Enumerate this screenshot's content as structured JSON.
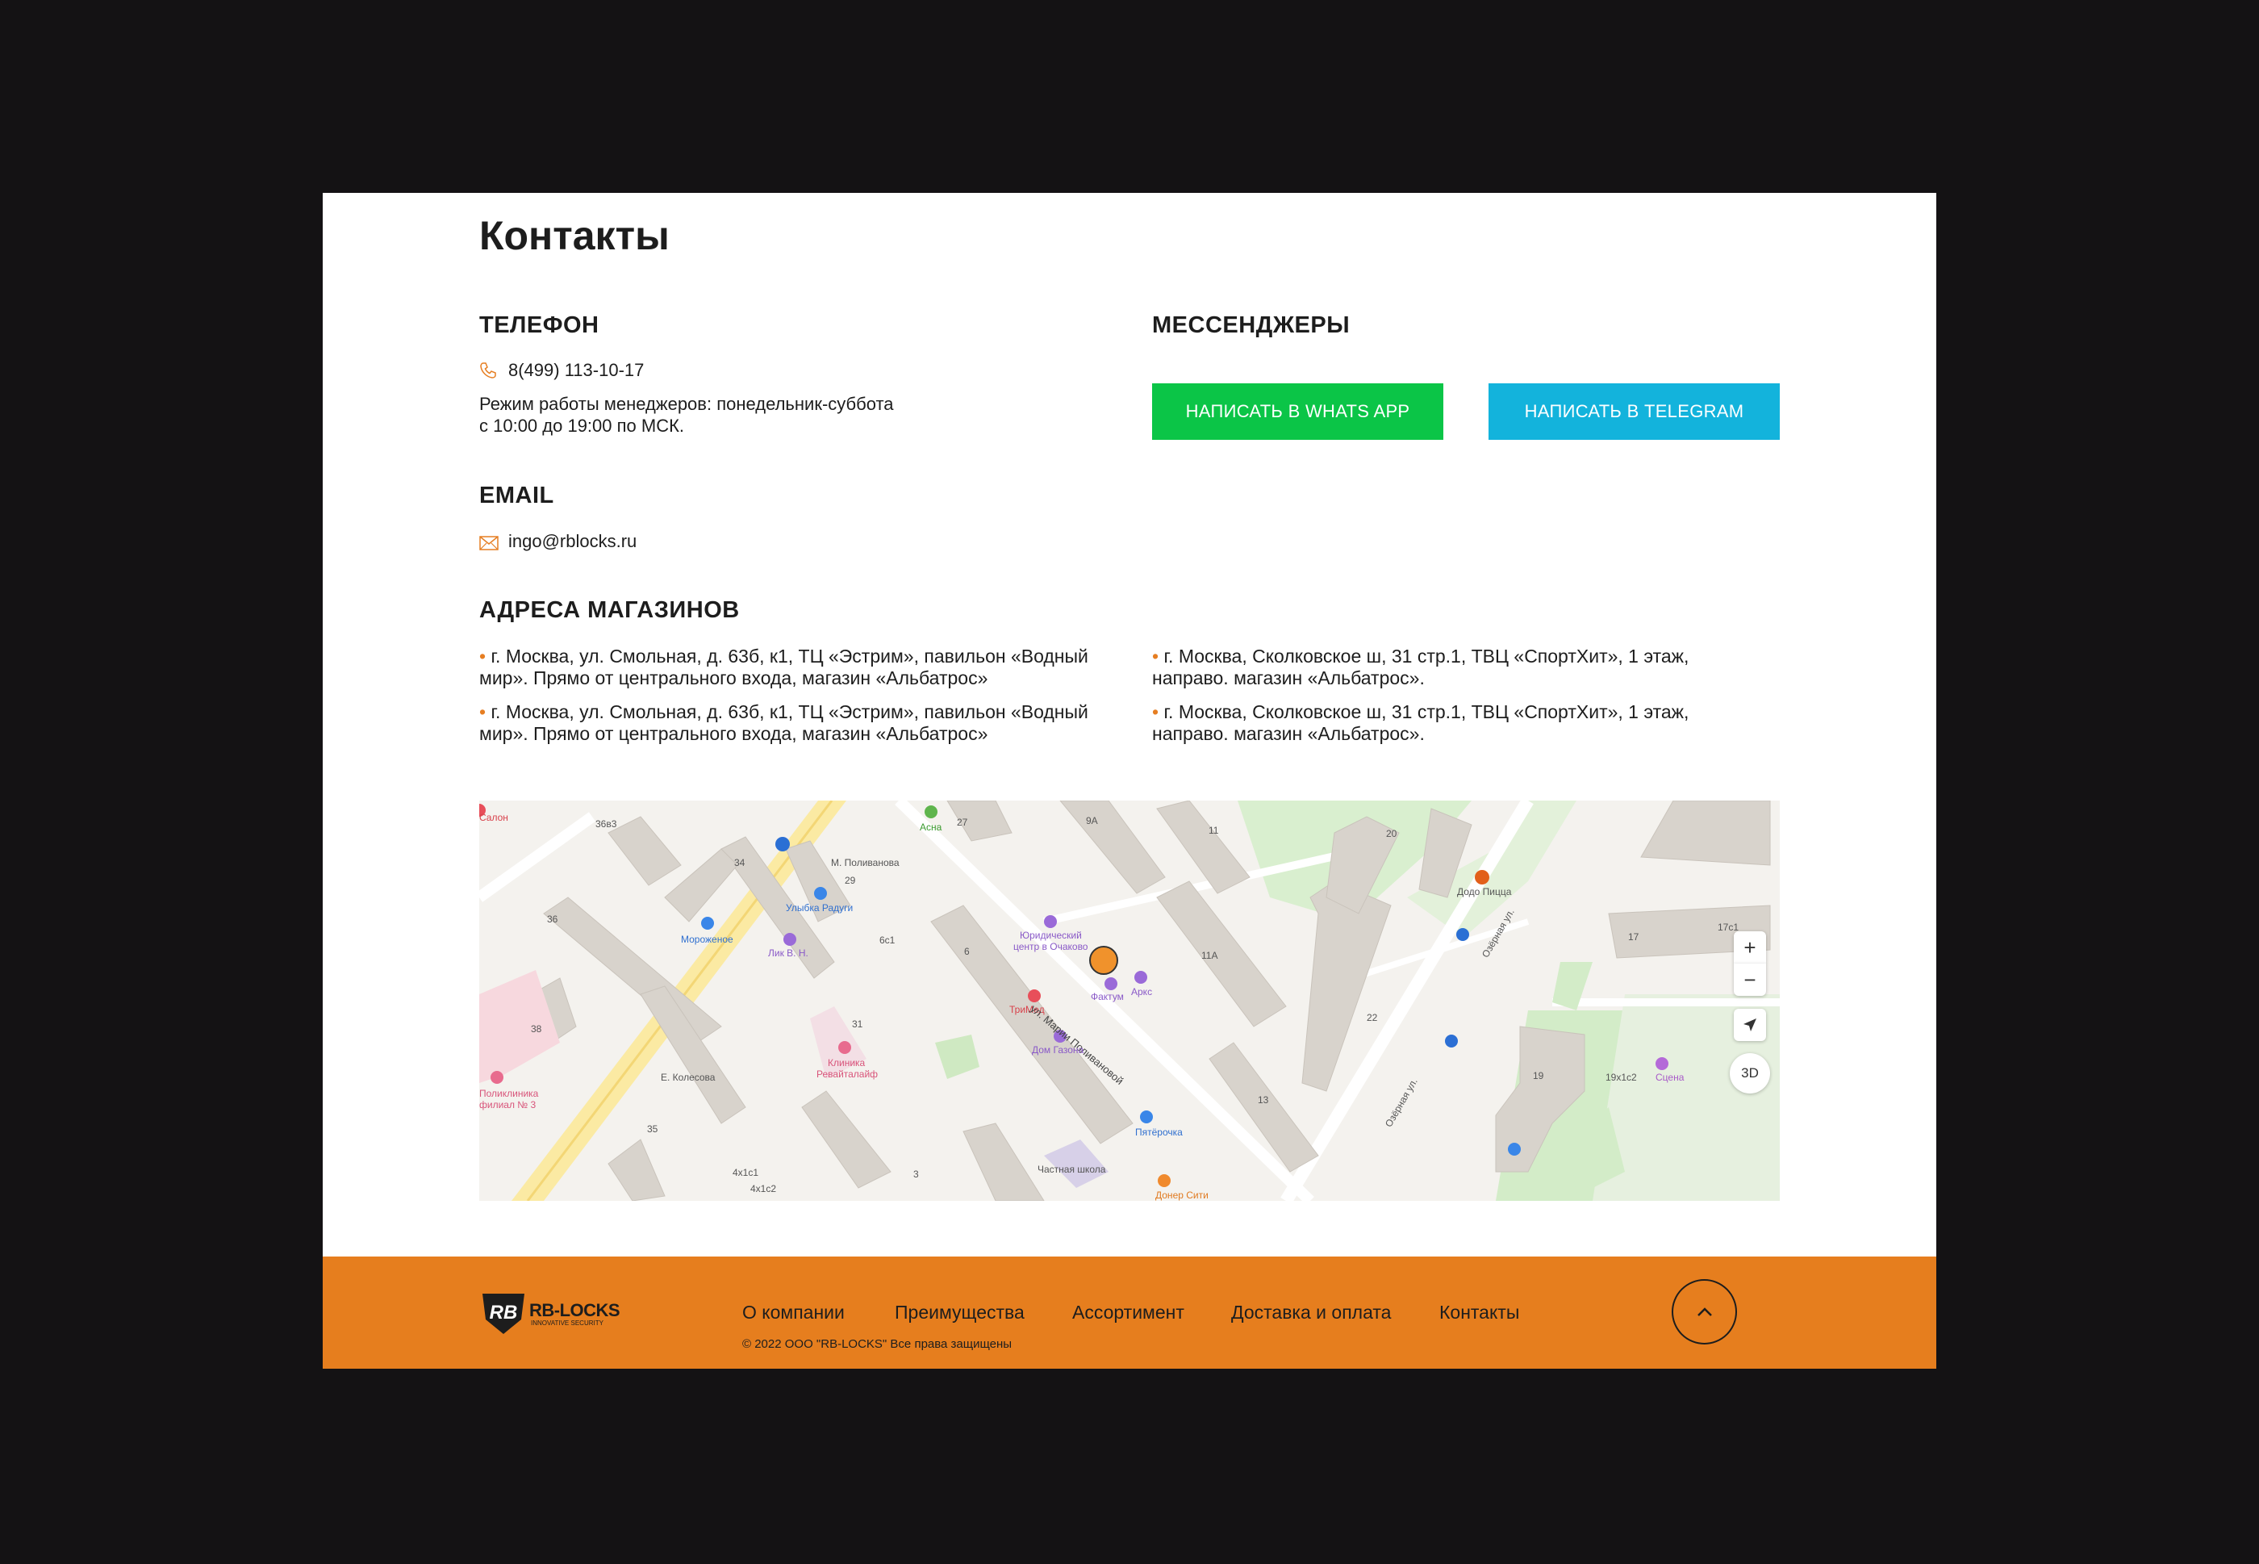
{
  "page_title": "Контакты",
  "phone": {
    "heading": "ТЕЛЕФОН",
    "number": "8(499) 113-10-17",
    "hours_line1": "Режим работы менеджеров: понедельник-суббота",
    "hours_line2": "с 10:00 до 19:00 по МСК."
  },
  "messengers": {
    "heading": "МЕССЕНДЖЕРЫ",
    "whatsapp_label": "НАПИСАТЬ В WHATS APP",
    "telegram_label": "НАПИСАТЬ В TELEGRAM"
  },
  "email": {
    "heading": "EMAIL",
    "address": "ingo@rblocks.ru"
  },
  "stores": {
    "heading": "АДРЕСА МАГАЗИНОВ",
    "items": [
      {
        "line1": "г. Москва, ул. Смольная, д. 63б, к1, ТЦ «Эстрим», павильон «Водный",
        "line2": "мир». Прямо от центрального входа, магазин «Альбатрос»"
      },
      {
        "line1": "г. Москва, Сколковское ш, 31 стр.1, ТВЦ «СпортХит», 1 этаж,",
        "line2": "направо. магазин «Альбатрос»."
      },
      {
        "line1": "г. Москва, ул. Смольная, д. 63б, к1, ТЦ «Эстрим», павильон «Водный",
        "line2": "мир». Прямо от центрального входа, магазин «Альбатрос»"
      },
      {
        "line1": "г. Москва, Сколковское ш, 31 стр.1, ТВЦ «СпортХит», 1 этаж,",
        "line2": "направо. магазин «Альбатрос»."
      }
    ]
  },
  "map": {
    "zoom_in": "+",
    "zoom_out": "−",
    "mode_3d": "3D",
    "labels": {
      "asna": "Асна",
      "polivanova": "М. Поливанова",
      "ulybka": "Улыбка Радуги",
      "morozhenoe": "Мороженое",
      "yurcentr1": "Юридический",
      "yurcentr2": "центр в Очаково",
      "faktum": "Фактум",
      "arks": "Аркс",
      "trimed": "ТриМед",
      "street": "ул. Марии Поливановой",
      "dom_gazona": "Дом Газона",
      "klinika1": "Клиника",
      "klinika2": "Ревайталайф",
      "kolesova": "Е. Колесова",
      "pyaterochka": "Пятёрочка",
      "shkola": "Частная школа",
      "doner": "Донер Сити",
      "dodo": "Додо Пицца",
      "ozernaya": "Озёрная ул.",
      "ozernaya2": "Озёрная ул.",
      "scena": "Сцена",
      "salon": "Салон",
      "poliklinika1": "Поликлиника",
      "poliklinika2": "филиал № 3",
      "lik": "Лик В. Н.",
      "h9a": "9А",
      "h11": "11",
      "h11a": "11А",
      "h20": "20",
      "h17": "17",
      "h17c1": "17с1",
      "h22": "22",
      "h13": "13",
      "h34": "34",
      "h36": "36",
      "h38": "38",
      "h29": "29",
      "h27": "27",
      "h31": "31",
      "h6": "6",
      "h6c1": "6с1",
      "h3": "3",
      "h35": "35",
      "h4x1c1": "4х1с1",
      "h4x1c2": "4х1с2",
      "h19": "19",
      "h19x1c2": "19х1с2",
      "h36b3": "36в3"
    }
  },
  "footer": {
    "logo_text": "RB-LOCKS",
    "logo_sub": "INNOVATIVE SECURITY",
    "nav": [
      "О компании",
      "Преимущества",
      "Ассортимент",
      "Доставка и оплата",
      "Контакты"
    ],
    "copyright": "© 2022 ООО \"RB-LOCKS\" Все права защищены"
  },
  "colors": {
    "accent": "#e67e1e",
    "whatsapp": "#0bc547",
    "telegram": "#13b3dc",
    "background": "#141214"
  },
  "icons": [
    "phone-icon",
    "mail-icon",
    "arrow-up-icon",
    "location-arrow-icon"
  ]
}
